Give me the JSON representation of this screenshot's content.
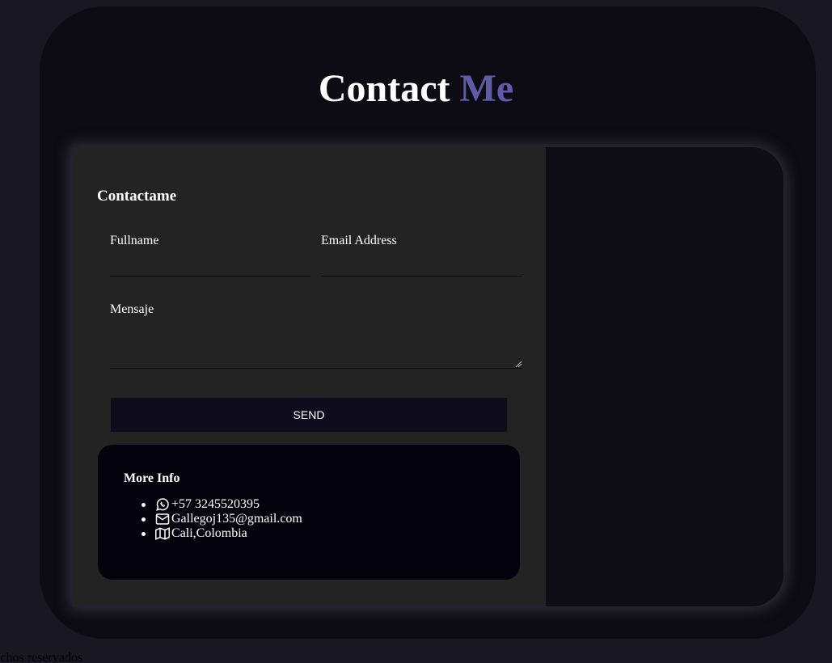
{
  "header": {
    "title_main": "Contact",
    "title_accent": "Me"
  },
  "form": {
    "title": "Contactame",
    "fullname_label": "Fullname",
    "fullname_value": "",
    "email_label": "Email Address",
    "email_value": "",
    "message_label": "Mensaje",
    "message_value": "",
    "send_label": "SEND"
  },
  "info": {
    "title": "More Info",
    "items": [
      {
        "icon": "whatsapp-icon",
        "text": "+57 3245520395"
      },
      {
        "icon": "mail-icon",
        "text": "Gallegoj135@gmail.com"
      },
      {
        "icon": "map-icon",
        "text": "Cali,Colombia"
      }
    ]
  },
  "footer": {
    "text": "rechos reservados"
  },
  "colors": {
    "background": "#191822",
    "panel": "#0d0c14",
    "form_bg": "#232323",
    "accent": "#5e5ca8",
    "button_bg": "#0e0c1d",
    "info_bg": "#04030d"
  }
}
